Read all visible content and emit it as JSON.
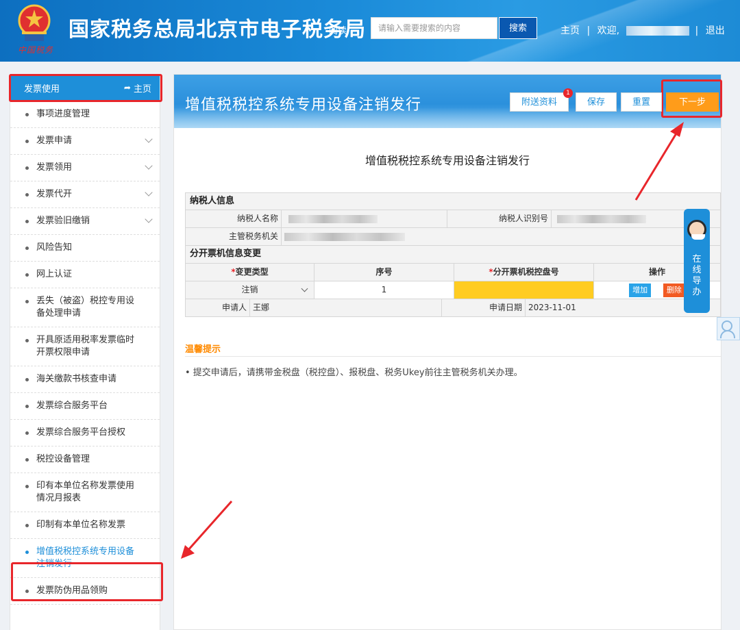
{
  "header": {
    "title": "国家税务总局北京市电子税务局",
    "emblem_text": "中国税务",
    "read_link": "阅读",
    "search_placeholder": "请输入需要搜索的内容",
    "search_button": "搜索",
    "nav": {
      "home": "主页",
      "sep1": "|",
      "welcome": "欢迎,",
      "sep2": "|",
      "logout": "退出"
    }
  },
  "sidebar": {
    "section_title": "发票使用",
    "home_link": "主页",
    "items": [
      {
        "label": "事项进度管理",
        "expandable": false
      },
      {
        "label": "发票申请",
        "expandable": true
      },
      {
        "label": "发票领用",
        "expandable": true
      },
      {
        "label": "发票代开",
        "expandable": true
      },
      {
        "label": "发票验旧缴销",
        "expandable": true
      },
      {
        "label": "风险告知",
        "expandable": false
      },
      {
        "label": "网上认证",
        "expandable": false
      },
      {
        "label": "丢失（被盗）税控专用设备处理申请",
        "expandable": false
      },
      {
        "label": "开具原适用税率发票临时开票权限申请",
        "expandable": false
      },
      {
        "label": "海关缴款书核查申请",
        "expandable": false
      },
      {
        "label": "发票综合服务平台",
        "expandable": false
      },
      {
        "label": "发票综合服务平台授权",
        "expandable": false
      },
      {
        "label": "税控设备管理",
        "expandable": false
      },
      {
        "label": "印有本单位名称发票使用情况月报表",
        "expandable": false
      },
      {
        "label": "印制有本单位名称发票",
        "expandable": false
      },
      {
        "label": "增值税税控系统专用设备注销发行",
        "expandable": false,
        "active": true
      },
      {
        "label": "发票防伪用品领购",
        "expandable": false
      }
    ]
  },
  "main": {
    "banner_title": "增值税税控系统专用设备注销发行",
    "buttons": {
      "attach": "附送资料",
      "save": "保存",
      "reset": "重置",
      "next": "下一步"
    },
    "attach_badge": "1",
    "form_title": "增值税税控系统专用设备注销发行",
    "taxpayer_section": "纳税人信息",
    "taxpayer_name_label": "纳税人名称",
    "taxpayer_id_label": "纳税人识别号",
    "tax_authority_label": "主管税务机关",
    "change_section": "分开票机信息变更",
    "table_headers": {
      "change_type": "变更类型",
      "seq": "序号",
      "disk_no": "分开票机税控盘号",
      "ops": "操作"
    },
    "required_mark": "*",
    "row": {
      "change_type": "注销",
      "seq": "1",
      "disk_no": ""
    },
    "op_add": "增加",
    "op_delete": "删除",
    "applicant_label": "申请人",
    "applicant_value": "王娜",
    "apply_date_label": "申请日期",
    "apply_date_value": "2023-11-01",
    "tips_title": "温馨提示",
    "tips_text": "•  提交申请后，请携带金税盘（税控盘）、报税盘、税务Ukey前往主管税务机关办理。"
  },
  "widgets": {
    "online_guide": "在线导办"
  },
  "colors": {
    "accent": "#1e8fd9",
    "next_button": "#ff9c1a",
    "highlight": "#e8262b",
    "tips": "#ff8a00",
    "required_field": "#ffcc22"
  }
}
